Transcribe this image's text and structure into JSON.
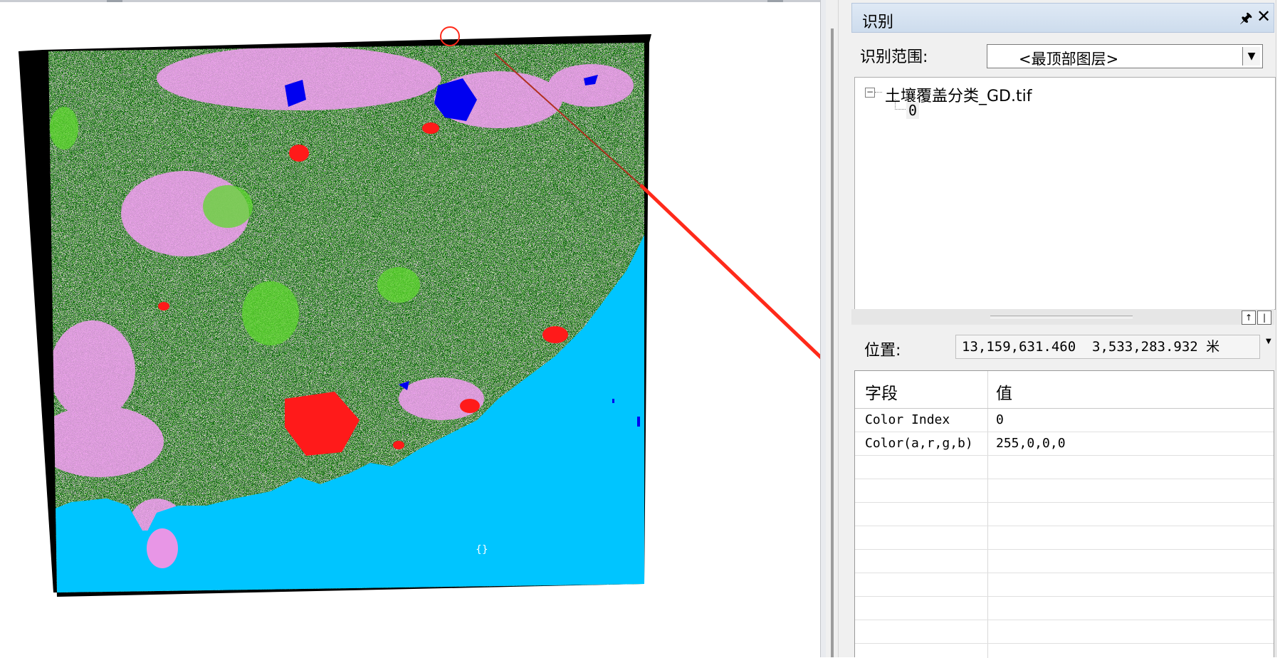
{
  "identify_panel": {
    "title": "识别",
    "pin_icon": "pin-icon",
    "close_icon": "close-icon",
    "scope_label": "识别范围:",
    "scope_value": "<最顶部图层>",
    "tree": {
      "layer_name": "土壤覆盖分类_GD.tif",
      "child_value": "0"
    },
    "location_label": "位置:",
    "location_value": "13,159,631.460  3,533,283.932 米",
    "table": {
      "headers": [
        "字段",
        "值"
      ],
      "rows": [
        [
          "Color Index",
          "0"
        ],
        [
          "Color(a,r,g,b)",
          "255,0,0,0"
        ]
      ]
    }
  },
  "map": {
    "legend_colors": {
      "forest": "#006400",
      "grassland": "#66ff33",
      "cropland": "#f29df2",
      "water": "#0000ff",
      "urban": "#ff0000",
      "sea": "#00c5ff",
      "nodata": "#000000"
    },
    "annotation_color": "#ff2a1a"
  }
}
